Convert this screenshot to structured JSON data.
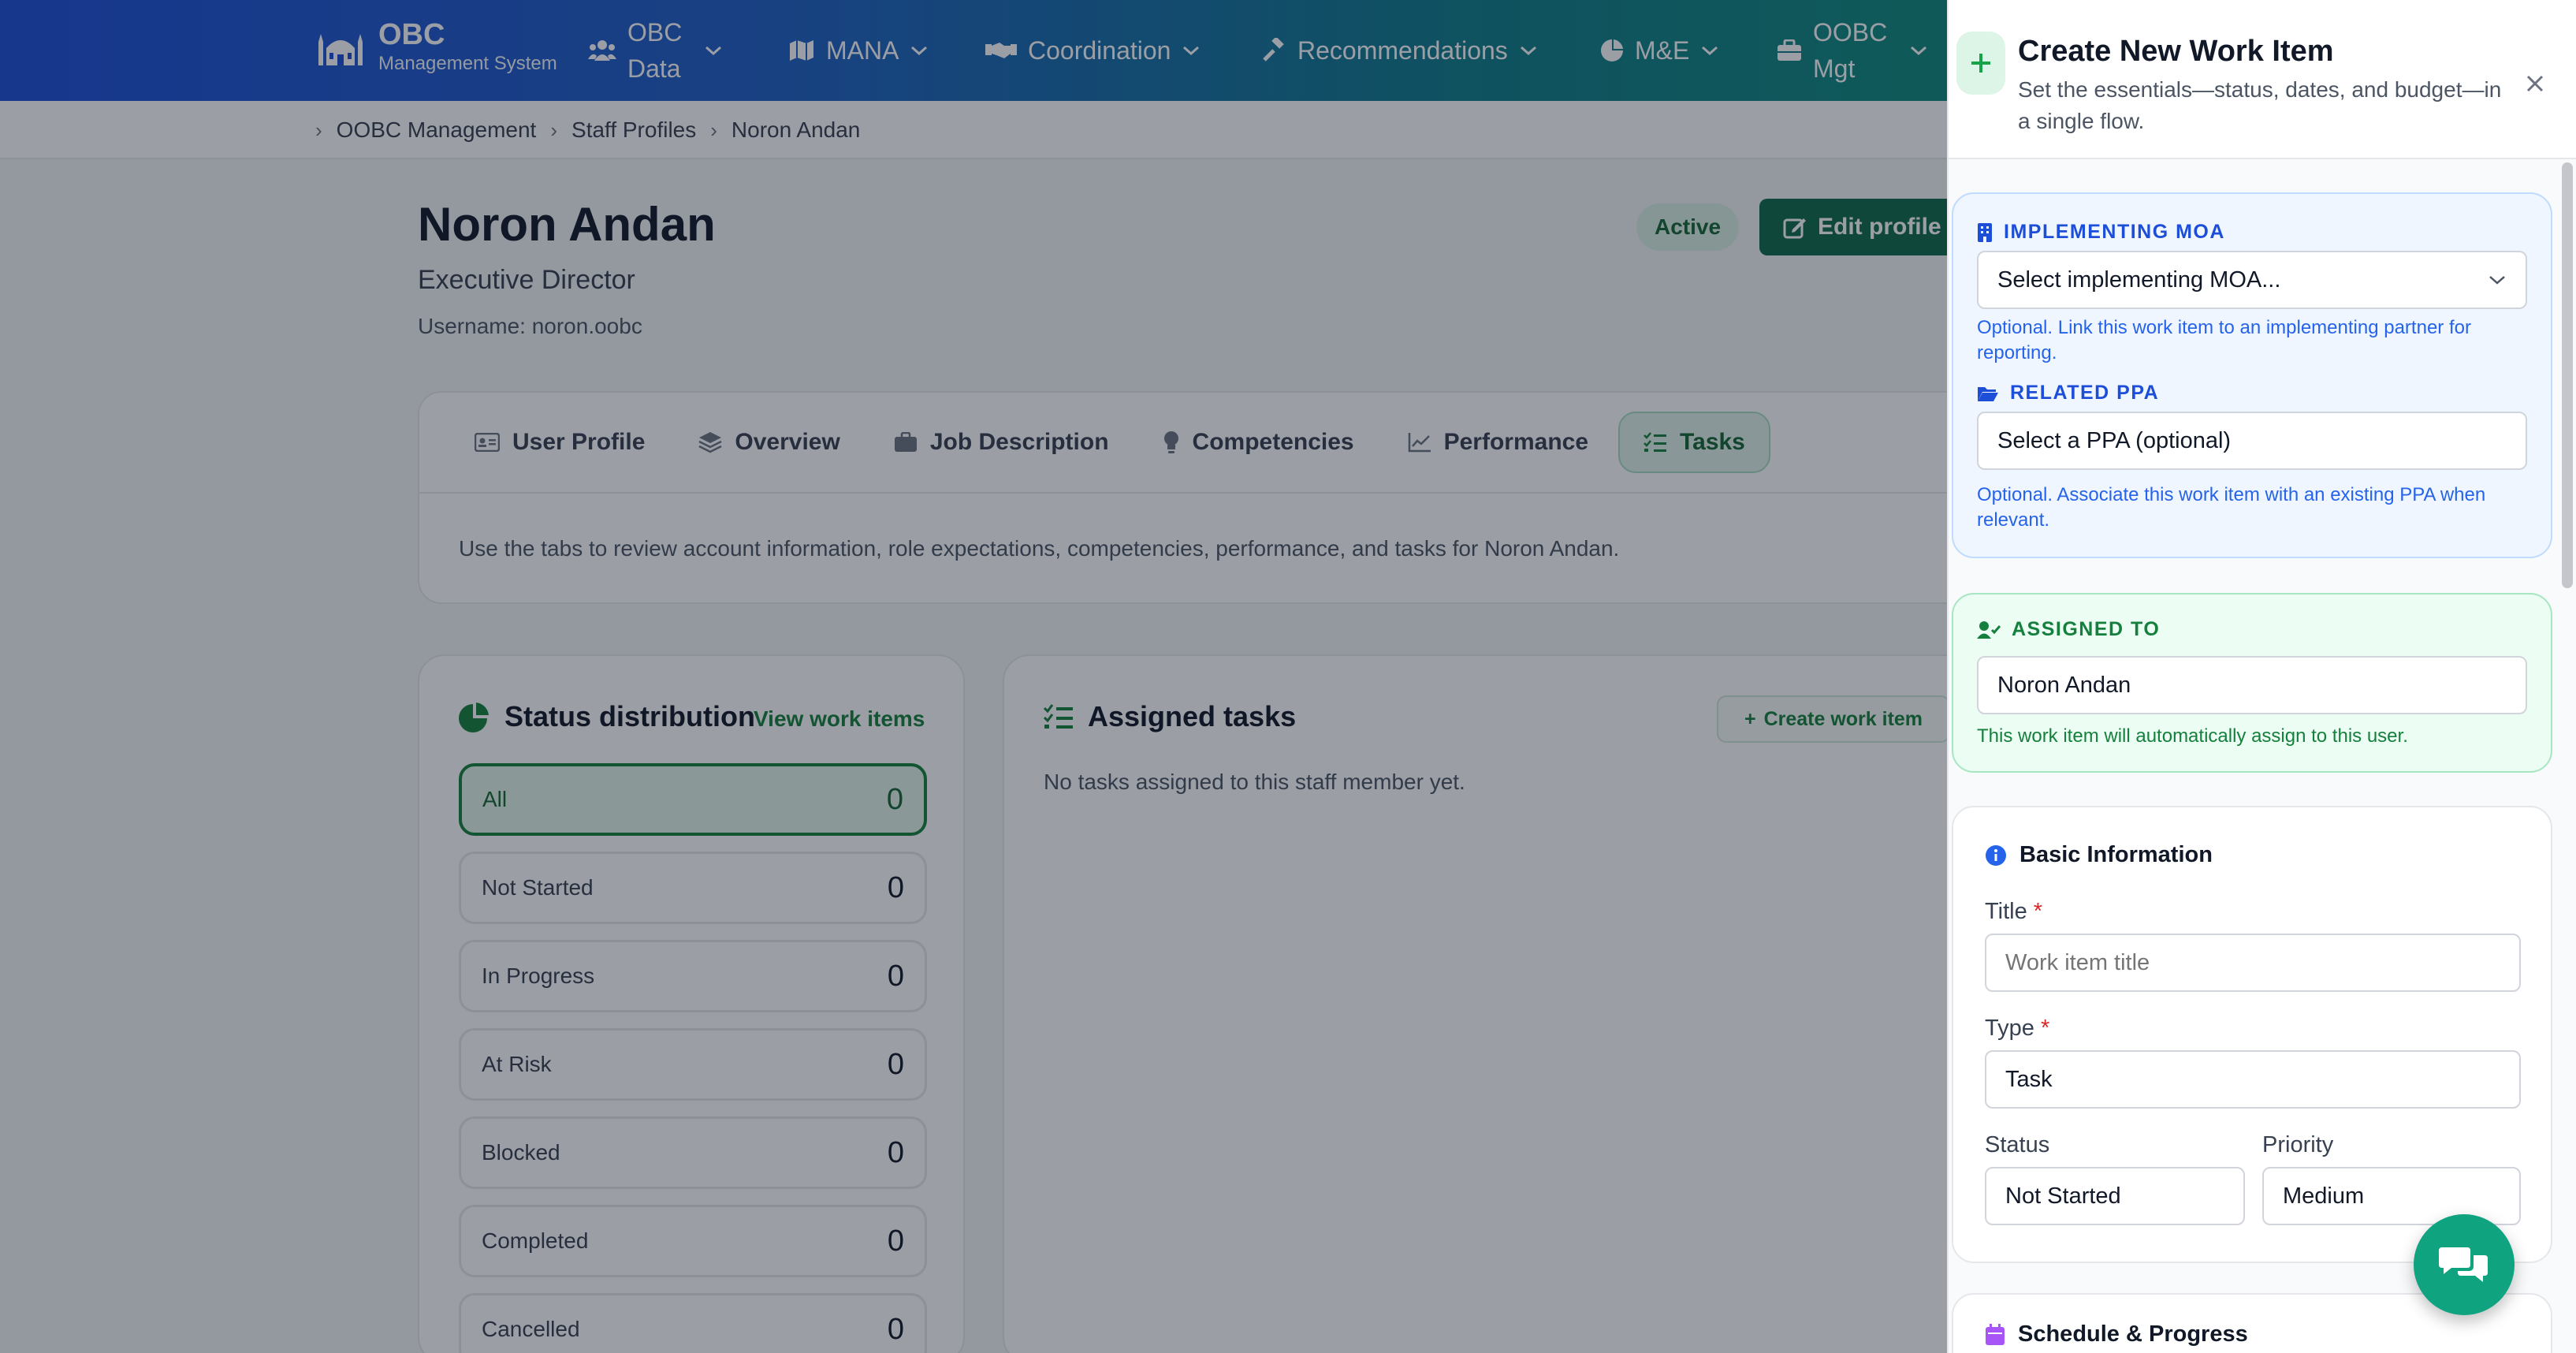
{
  "brand": {
    "title": "OBC",
    "subtitle": "Management System"
  },
  "nav": [
    {
      "line1": "OBC",
      "line2": "Data"
    },
    {
      "label": "MANA"
    },
    {
      "label": "Coordination"
    },
    {
      "label": "Recommendations"
    },
    {
      "label": "M&E"
    },
    {
      "line1": "OOBC",
      "line2": "Mgt"
    }
  ],
  "breadcrumb": [
    "OOBC Management",
    "Staff Profiles",
    "Noron Andan"
  ],
  "profile": {
    "name": "Noron Andan",
    "role": "Executive Director",
    "username": "Username: noron.oobc",
    "status": "Active",
    "edit_label": "Edit profile"
  },
  "tabs": {
    "items": [
      "User Profile",
      "Overview",
      "Job Description",
      "Competencies",
      "Performance",
      "Tasks"
    ],
    "active": "Tasks",
    "description": "Use the tabs to review account information, role expectations, competencies, performance, and tasks for Noron Andan."
  },
  "status_distribution": {
    "title": "Status distribution",
    "link": "View work items",
    "rows": [
      {
        "label": "All",
        "count": "0"
      },
      {
        "label": "Not Started",
        "count": "0"
      },
      {
        "label": "In Progress",
        "count": "0"
      },
      {
        "label": "At Risk",
        "count": "0"
      },
      {
        "label": "Blocked",
        "count": "0"
      },
      {
        "label": "Completed",
        "count": "0"
      },
      {
        "label": "Cancelled",
        "count": "0"
      }
    ]
  },
  "assigned_tasks": {
    "title": "Assigned tasks",
    "create_label": "Create work item",
    "empty": "No tasks assigned to this staff member yet."
  },
  "drawer": {
    "title": "Create New Work Item",
    "subtitle": "Set the essentials—status, dates, and budget—in a single flow.",
    "moa": {
      "label": "IMPLEMENTING MOA",
      "value": "Select implementing MOA...",
      "hint": "Optional. Link this work item to an implementing partner for reporting."
    },
    "ppa": {
      "label": "RELATED PPA",
      "value": "Select a PPA (optional)",
      "hint": "Optional. Associate this work item with an existing PPA when relevant."
    },
    "assigned": {
      "label": "ASSIGNED TO",
      "value": "Noron Andan",
      "hint": "This work item will automatically assign to this user."
    },
    "basic": {
      "heading": "Basic Information",
      "title_label": "Title",
      "title_placeholder": "Work item title",
      "type_label": "Type",
      "type_value": "Task",
      "status_label": "Status",
      "status_value": "Not Started",
      "priority_label": "Priority",
      "priority_value": "Medium"
    },
    "schedule_heading": "Schedule & Progress"
  },
  "colors": {
    "nav_start": "#1d4ed8",
    "nav_end": "#0f8a7e",
    "accent_green": "#15803d",
    "primary_button": "#0f6b4a",
    "chat_fab": "#10a37f"
  }
}
